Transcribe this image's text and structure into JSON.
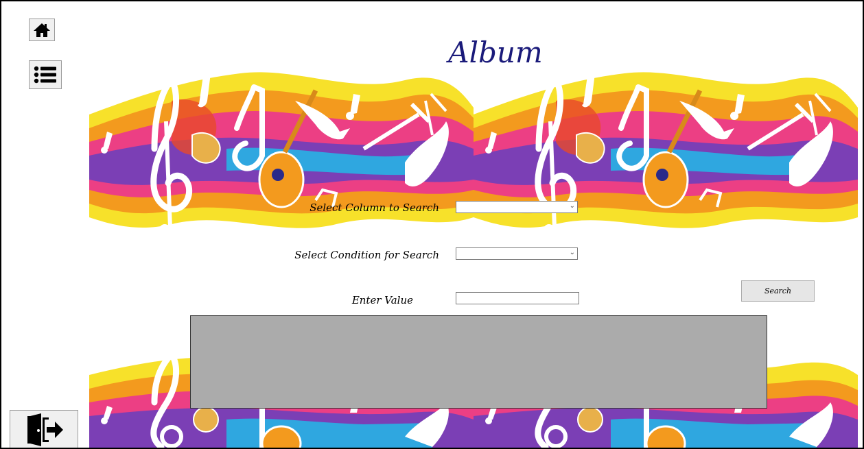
{
  "window": {
    "title": "Album"
  },
  "sidebar": {
    "home": {
      "icon": "home-icon"
    },
    "menu": {
      "icon": "list-icon"
    },
    "exit": {
      "icon": "exit-door-icon"
    }
  },
  "search_form": {
    "column_label": "Select Column to Search",
    "column_value": "",
    "condition_label": "Select Condition for Search",
    "condition_value": "",
    "value_label": "Enter Value",
    "value_text": "",
    "search_button": "Search"
  },
  "colors": {
    "title": "#1a1a7a",
    "results_grid": "#ababab",
    "banner": [
      "#f7e12a",
      "#f39a1e",
      "#ec3f84",
      "#7b3fb5",
      "#2fa7e0",
      "#e84a2a"
    ]
  }
}
